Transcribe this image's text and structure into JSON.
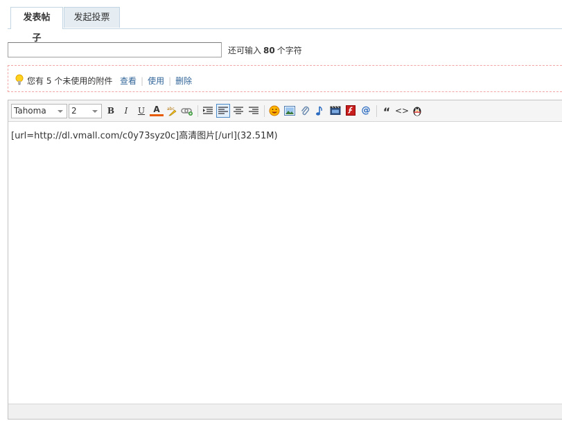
{
  "tabs": [
    {
      "label": "发表帖子",
      "active": true
    },
    {
      "label": "发起投票",
      "active": false
    }
  ],
  "title_field": {
    "value": "",
    "placeholder": ""
  },
  "char_count": {
    "prefix": "还可输入",
    "count": "80",
    "suffix": "个字符"
  },
  "attachments": {
    "notice_prefix": "您有",
    "count": "5",
    "notice_suffix": "个未使用的附件",
    "links": {
      "view": "查看",
      "use": "使用",
      "delete": "删除"
    }
  },
  "toolbar": {
    "font_family": "Tahoma",
    "font_size": "2",
    "bold": "B",
    "italic": "I",
    "underline": "U",
    "font_color": "A",
    "quote": "“",
    "code": "<>",
    "at": "@"
  },
  "editor": {
    "content": "[url=http://dl.vmall.com/c0y73syz0c]高清图片[/url](32.51M)"
  },
  "colors": {
    "accent": "#336699",
    "tab_border": "#c2d5e3",
    "inactive_tab_bg": "#e5edf2",
    "attach_border": "#f2a3a3"
  }
}
